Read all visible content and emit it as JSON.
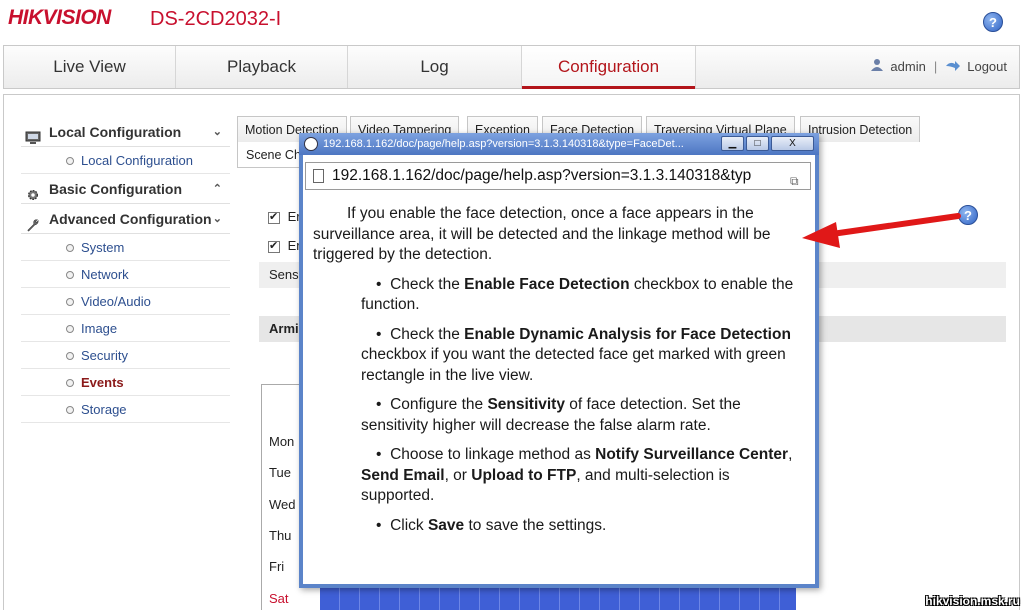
{
  "brand": "HIKVISION",
  "model": "DS-2CD2032-I",
  "help_icon": "?",
  "nav": {
    "tabs": [
      "Live View",
      "Playback",
      "Log",
      "Configuration"
    ],
    "active": "Configuration",
    "user": "admin",
    "separator": "|",
    "logout": "Logout"
  },
  "sidebar": {
    "sections": [
      {
        "label": "Local Configuration",
        "icon": "monitor-icon",
        "chevron": "⌄"
      },
      {
        "label": "Basic Configuration",
        "icon": "gear-icon",
        "chevron": "⌃"
      },
      {
        "label": "Advanced Configuration",
        "icon": "wrench-icon",
        "chevron": "⌄"
      }
    ],
    "local_items": [
      "Local Configuration"
    ],
    "advanced_items": [
      "System",
      "Network",
      "Video/Audio",
      "Image",
      "Security",
      "Events",
      "Storage"
    ],
    "active_item": "Events"
  },
  "content": {
    "tabs": [
      "Motion Detection",
      "Video Tampering",
      "Exception",
      "Face Detection",
      "Traversing Virtual Plane",
      "Intrusion Detection"
    ],
    "scene_tab": "Scene Ch",
    "checkbox_1": "Er",
    "checkbox_2": "Er",
    "sensitivity_label": "Sens",
    "arming_label": "Armi",
    "days": [
      "Mon",
      "Tue",
      "Wed",
      "Thu",
      "Fri",
      "Sat"
    ]
  },
  "popup": {
    "title": "192.168.1.162/doc/page/help.asp?version=3.1.3.140318&type=FaceDet...",
    "address": "192.168.1.162/doc/page/help.asp?version=3.1.3.140318&typ",
    "minimize": "▁",
    "maximize": "□",
    "close": "X",
    "intro": "If you enable the face detection, once a face appears in the surveillance area, it will be detected and the linkage method will be triggered by the detection.",
    "bullets": [
      {
        "pre": "Check the ",
        "b1": "Enable Face Detection",
        "mid": " checkbox to enable the function.",
        "b2": "",
        "mid2": "",
        "b3": "",
        "post": ""
      },
      {
        "pre": "Check the ",
        "b1": "Enable Dynamic Analysis for Face Detection",
        "mid": " checkbox if you want the detected face get marked with green rectangle in the live view.",
        "b2": "",
        "mid2": "",
        "b3": "",
        "post": ""
      },
      {
        "pre": "Configure the ",
        "b1": "Sensitivity",
        "mid": " of face detection. Set the sensitivity higher will decrease the false alarm rate.",
        "b2": "",
        "mid2": "",
        "b3": "",
        "post": ""
      },
      {
        "pre": "Choose to linkage method as ",
        "b1": "Notify Surveillance Center",
        "mid": ", ",
        "b2": "Send Email",
        "mid2": ", or ",
        "b3": "Upload to FTP",
        "post": ", and multi-selection is supported."
      },
      {
        "pre": "Click ",
        "b1": "Save",
        "mid": " to save the settings.",
        "b2": "",
        "mid2": "",
        "b3": "",
        "post": ""
      }
    ],
    "bullet_char": "•"
  },
  "watermark": "hikvision.msk.ru",
  "colors": {
    "brand_red": "#c8102e",
    "active_tab_red": "#b3151b",
    "popup_blue": "#5b84c9",
    "schedule_blue": "#3f5fd6",
    "arrow_red": "#e01818"
  }
}
